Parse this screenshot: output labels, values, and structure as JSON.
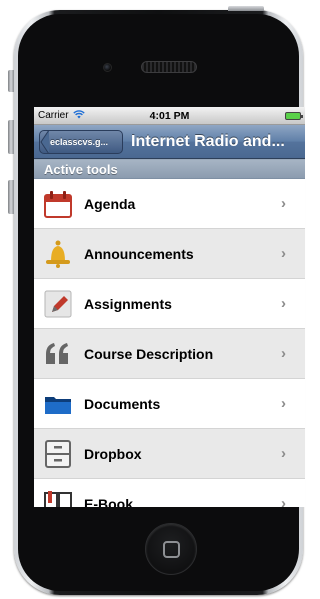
{
  "statusbar": {
    "carrier": "Carrier",
    "time": "4:01 PM"
  },
  "navbar": {
    "back_label": "eclasscvs.g...",
    "title": "Internet Radio and..."
  },
  "section": {
    "title": "Active tools"
  },
  "tools": [
    {
      "label": "Agenda",
      "icon": "calendar-icon"
    },
    {
      "label": "Announcements",
      "icon": "bell-icon"
    },
    {
      "label": "Assignments",
      "icon": "pencil-icon"
    },
    {
      "label": "Course Description",
      "icon": "quote-icon"
    },
    {
      "label": "Documents",
      "icon": "folder-icon"
    },
    {
      "label": "Dropbox",
      "icon": "drawer-icon"
    },
    {
      "label": "E-Book",
      "icon": "book-icon"
    }
  ],
  "colors": {
    "nav_bar": "#5f7fa8",
    "section_header": "#95a4b6",
    "row_alt": "#e9e9e9"
  }
}
